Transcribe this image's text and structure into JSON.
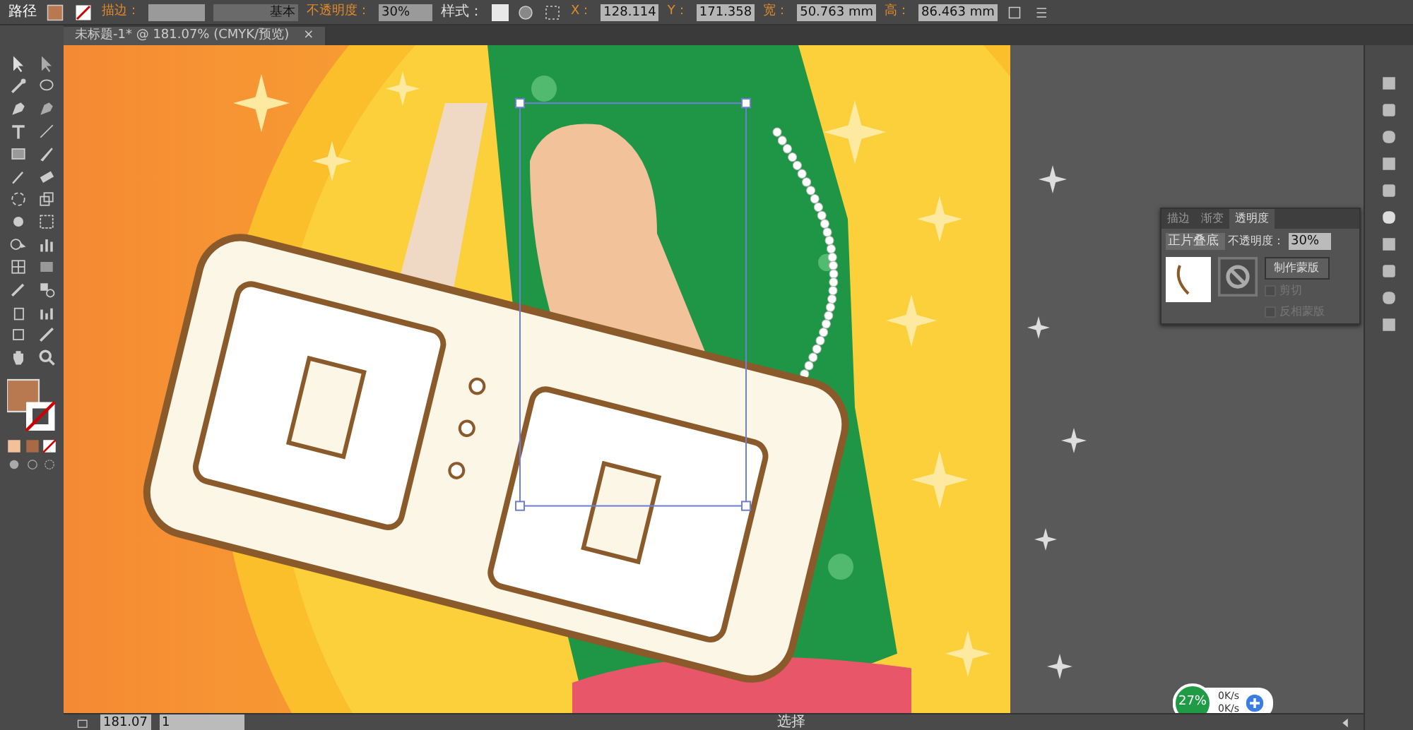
{
  "control_bar": {
    "object_type": "路径",
    "stroke_label": "描边：",
    "stroke_style": "基本",
    "opacity_label": "不透明度：",
    "opacity_value": "30%",
    "style_label": "样式：",
    "x_label": "X：",
    "x_value": "128.114",
    "y_label": "Y：",
    "y_value": "171.358",
    "w_label": "宽：",
    "w_value": "50.763 mm",
    "h_label": "高：",
    "h_value": "86.463 mm"
  },
  "document_tab": {
    "title": "未标题-1* @ 181.07% (CMYK/预览)",
    "close": "×"
  },
  "transparency_panel": {
    "tabs": [
      {
        "label": "描边",
        "selected": false
      },
      {
        "label": "渐变",
        "selected": false
      },
      {
        "label": "透明度",
        "selected": true
      }
    ],
    "blend_mode": "正片叠底",
    "opacity_label": "不透明度：",
    "opacity_value": "30%",
    "make_mask_button": "制作蒙版",
    "options": [
      {
        "label": "剪切",
        "checked": false,
        "disabled": true
      },
      {
        "label": "反相蒙版",
        "checked": false,
        "disabled": true
      }
    ]
  },
  "status_bar": {
    "zoom": "181.07",
    "page": "1",
    "status": "选择"
  },
  "network_widget": {
    "cpu": "27%",
    "upload": "0K/s",
    "download": "0K/s"
  }
}
